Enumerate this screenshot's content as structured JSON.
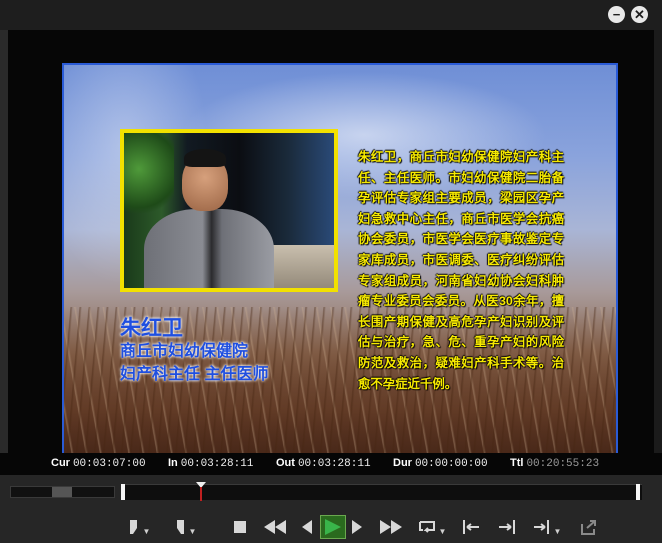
{
  "window": {
    "minimize_icon": "minimize-icon",
    "close_icon": "close-icon"
  },
  "video": {
    "name": "朱红卫",
    "org": "商丘市妇幼保健院",
    "job": "妇产科主任  主任医师",
    "bio": "朱红卫，商丘市妇幼保健院妇产科主任、主任医师。市妇幼保健院二胎备孕评估专家组主要成员，梁园区孕产妇急救中心主任，商丘市医学会抗癌协会委员，市医学会医疗事故鉴定专家库成员，市医调委、医疗纠纷评估专家组成员，河南省妇幼协会妇科肿瘤专业委员会委员。从医30余年，擅长围产期保健及高危孕产妇识别及评估与治疗，急、危、重孕产妇的风险防范及救治，疑难妇产科手术等。治愈不孕症近千例。"
  },
  "timecodes": {
    "cur_label": "Cur",
    "cur_value": "00:03:07:00",
    "in_label": "In",
    "in_value": "00:03:28:11",
    "out_label": "Out",
    "out_value": "00:03:28:11",
    "dur_label": "Dur",
    "dur_value": "00:00:00:00",
    "ttl_label": "Ttl",
    "ttl_value": "00:20:55:23"
  },
  "scrub": {
    "playhead_fraction": 0.15
  },
  "controls": {
    "buttons": [
      "mark-in-icon",
      "mark-out-icon",
      "stop-icon",
      "fast-rewind-icon",
      "step-back-icon",
      "play-icon",
      "step-forward-icon",
      "fast-forward-icon",
      "loop-icon",
      "go-to-in-icon",
      "go-to-out-icon",
      "jump-icon",
      "export-icon"
    ],
    "colors": {
      "play_bg": "#2a6a1e",
      "name_text": "#1f4fe0",
      "bio_text": "#f7ea00",
      "frame_border": "#2a5bd6",
      "photo_border": "#f2e100"
    }
  }
}
